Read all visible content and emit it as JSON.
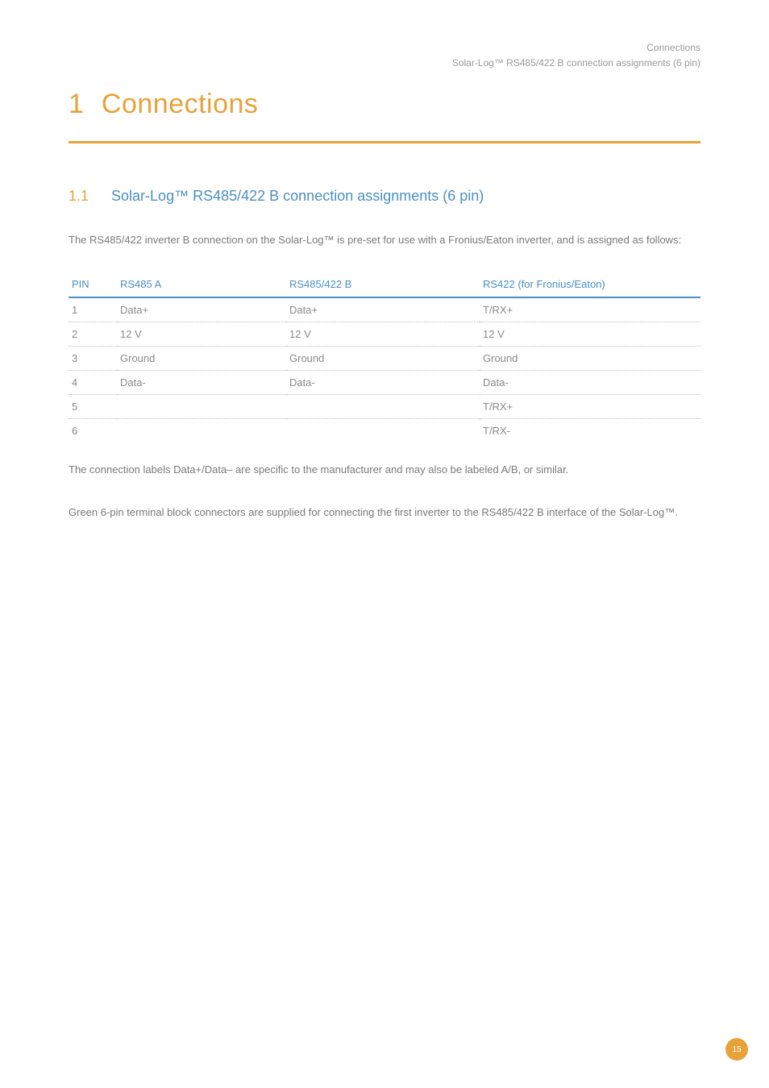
{
  "running_head": {
    "line1": "Connections",
    "line2": "Solar-Log™ RS485/422 B connection assignments (6 pin)"
  },
  "chapter": {
    "num": "1",
    "title": "Connections"
  },
  "section": {
    "num": "1.1",
    "title": "Solar-Log™ RS485/422 B connection assignments (6 pin)"
  },
  "intro": "The RS485/422 inverter B connection on the Solar-Log™ is pre-set for use with a Fronius/Eaton inverter, and is assigned as follows:",
  "table": {
    "headers": {
      "pin": "PIN",
      "a": "RS485 A",
      "b": "RS485/422 B",
      "c": "RS422 (for Fronius/Eaton)"
    },
    "rows": [
      {
        "pin": "1",
        "a": "Data+",
        "b": "Data+",
        "c": "T/RX+"
      },
      {
        "pin": "2",
        "a": "12 V",
        "b": "12 V",
        "c": "12 V"
      },
      {
        "pin": "3",
        "a": "Ground",
        "b": "Ground",
        "c": "Ground"
      },
      {
        "pin": "4",
        "a": "Data-",
        "b": "Data-",
        "c": "Data-"
      },
      {
        "pin": "5",
        "a": "",
        "b": "",
        "c": "T/RX+"
      },
      {
        "pin": "6",
        "a": "",
        "b": "",
        "c": "T/RX-"
      }
    ]
  },
  "note1": "The connection labels Data+/Data– are specific to the manufacturer and may also be labeled A/B, or similar.",
  "note2": "Green 6-pin terminal block connectors are supplied for connecting the first inverter to the RS485/422 B interface of the Solar-Log™.",
  "page_number": "15"
}
